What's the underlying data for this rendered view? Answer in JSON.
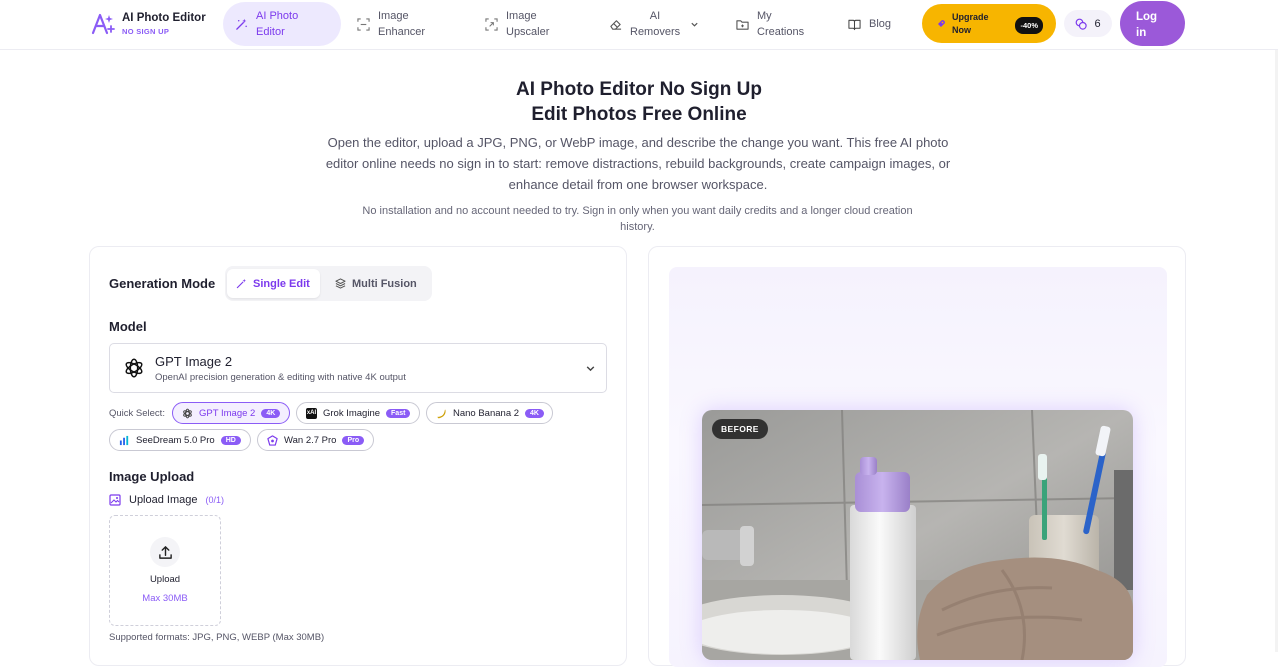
{
  "nav": {
    "logo_title": "AI Photo Editor",
    "logo_sub": "NO SIGN UP",
    "items": [
      {
        "label": "AI Photo Editor",
        "icon": "magic-wand-icon"
      },
      {
        "label": "Image Enhancer",
        "icon": "enhance-frame-icon"
      },
      {
        "label": "Image Upscaler",
        "icon": "upscale-frame-icon"
      },
      {
        "label": "AI Removers",
        "icon": "eraser-icon"
      },
      {
        "label": "My Creations",
        "icon": "folder-icon"
      },
      {
        "label": "Blog",
        "icon": "book-icon"
      }
    ],
    "upgrade_label": "Upgrade Now",
    "upgrade_badge": "-40%",
    "credits": "6",
    "login_label": "Log in",
    "accent": "#8b5cf6",
    "upgrade_color": "#f7b500"
  },
  "hero": {
    "title_line1": "AI Photo Editor No Sign Up",
    "title_line2": "Edit Photos Free Online",
    "description": "Open the editor, upload a JPG, PNG, or WebP image, and describe the change you want. This free AI photo editor online needs no sign in to start: remove distractions, rebuild backgrounds, create campaign images, or enhance detail from one browser workspace.",
    "note": "No installation and no account needed to try. Sign in only when you want daily credits and a longer cloud creation history."
  },
  "editor": {
    "generation_mode_label": "Generation Mode",
    "mode_single": "Single Edit",
    "mode_multi": "Multi Fusion",
    "model_label": "Model",
    "model_name": "GPT Image 2",
    "model_desc": "OpenAI precision generation & editing with native 4K output",
    "quick_select_label": "Quick Select:",
    "quick_models": [
      {
        "name": "GPT Image 2",
        "tag": "4K",
        "icon": "openai-icon",
        "selected": true
      },
      {
        "name": "Grok Imagine",
        "tag": "Fast",
        "icon": "xai-icon",
        "selected": false
      },
      {
        "name": "Nano Banana 2",
        "tag": "4K",
        "icon": "banana-icon",
        "selected": false
      },
      {
        "name": "SeeDream 5.0 Pro",
        "tag": "HD",
        "icon": "seedream-icon",
        "selected": false
      },
      {
        "name": "Wan 2.7 Pro",
        "tag": "Pro",
        "icon": "wan-icon",
        "selected": false
      }
    ],
    "image_upload_label": "Image Upload",
    "upload_image_label": "Upload Image",
    "upload_count": "(0/1)",
    "upload_button": "Upload",
    "upload_max": "Max 30MB",
    "supported_formats": "Supported formats: JPG, PNG, WEBP (Max 30MB)"
  },
  "preview": {
    "badge": "BEFORE"
  }
}
